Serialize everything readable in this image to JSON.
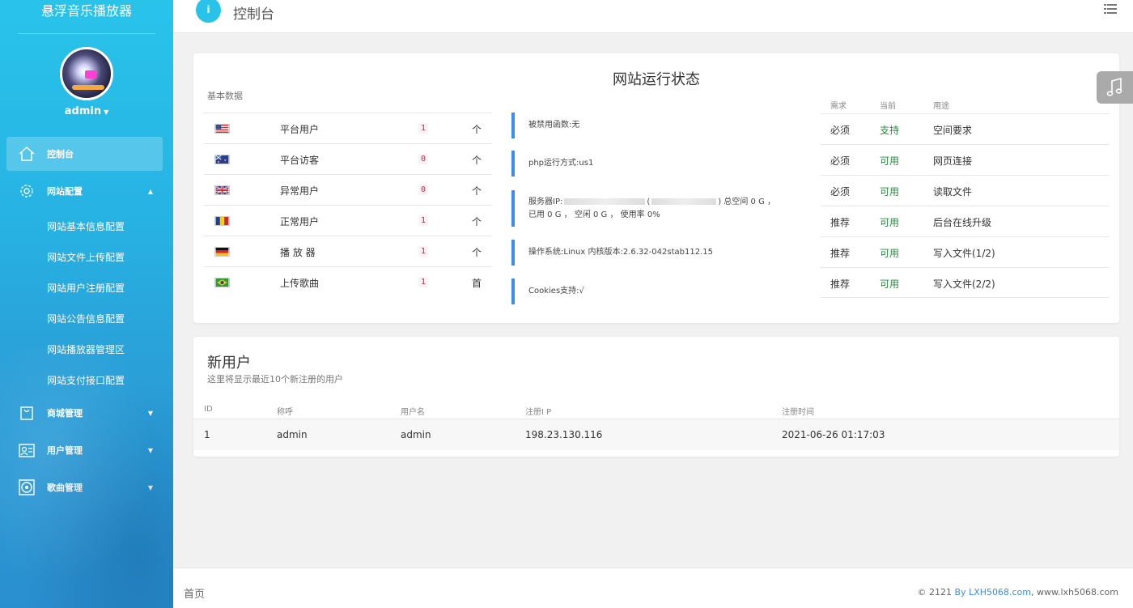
{
  "sidebar": {
    "brand": "悬浮音乐播放器",
    "user": "admin",
    "items": [
      {
        "label": "控制台",
        "icon": "home-icon"
      },
      {
        "label": "网站配置",
        "icon": "gear-icon"
      },
      {
        "label": "商城管理",
        "icon": "bag-icon"
      },
      {
        "label": "用户管理",
        "icon": "id-card-icon"
      },
      {
        "label": "歌曲管理",
        "icon": "disc-icon"
      }
    ],
    "submenu": [
      "网站基本信息配置",
      "网站文件上传配置",
      "网站用户注册配置",
      "网站公告信息配置",
      "网站播放器管理区",
      "网站支付接口配置"
    ]
  },
  "header": {
    "title": "控制台",
    "info_glyph": "i"
  },
  "status": {
    "title": "网站运行状态",
    "basic_label": "基本数据",
    "basic": [
      {
        "flag": "us",
        "label": "平台用户",
        "value": "1",
        "unit": "个"
      },
      {
        "flag": "au",
        "label": "平台访客",
        "value": "0",
        "unit": "个"
      },
      {
        "flag": "gb",
        "label": "异常用户",
        "value": "0",
        "unit": "个"
      },
      {
        "flag": "ro",
        "label": "正常用户",
        "value": "1",
        "unit": "个"
      },
      {
        "flag": "de",
        "label": "播 放 器",
        "value": "1",
        "unit": "个"
      },
      {
        "flag": "br",
        "label": "上传歌曲",
        "value": "1",
        "unit": "首"
      }
    ],
    "info": {
      "disabled_funcs": "被禁用函数:无",
      "php_mode": "php运行方式:us1",
      "server_prefix": "服务器IP:",
      "server_paren": "(",
      "server_suffix": ") 总空间 0 G ， 已用 0 G ， 空闲 0 G ， 使用率 0%",
      "os": "操作系统:Linux  内核版本:2.6.32-042stab112.15",
      "cookies": "Cookies支持:√"
    },
    "req_head": {
      "need": "需求",
      "current": "当前",
      "use": "用途"
    },
    "req": [
      {
        "need": "必须",
        "current": "支持",
        "use": "空间要求"
      },
      {
        "need": "必须",
        "current": "可用",
        "use": "网页连接"
      },
      {
        "need": "必须",
        "current": "可用",
        "use": "读取文件"
      },
      {
        "need": "推荐",
        "current": "可用",
        "use": "后台在线升级"
      },
      {
        "need": "推荐",
        "current": "可用",
        "use": "写入文件(1/2)"
      },
      {
        "need": "推荐",
        "current": "可用",
        "use": "写入文件(2/2)"
      }
    ]
  },
  "new_users": {
    "title": "新用户",
    "subtitle": "这里将显示最近10个新注册的用户",
    "columns": [
      "ID",
      "称呼",
      "用户名",
      "注册I P",
      "注册时间"
    ],
    "rows": [
      [
        "1",
        "admin",
        "admin",
        "198.23.130.116",
        "2021-06-26 01:17:03"
      ]
    ]
  },
  "footer": {
    "home": "首页",
    "copy_prefix": "© 2121 ",
    "copy_link": "By LXH5068.com",
    "copy_suffix": ", www.lxh5068.com"
  },
  "colors": {
    "accent": "#29c3ea",
    "ok": "#1f8f3a",
    "bar": "#3c8dec"
  }
}
